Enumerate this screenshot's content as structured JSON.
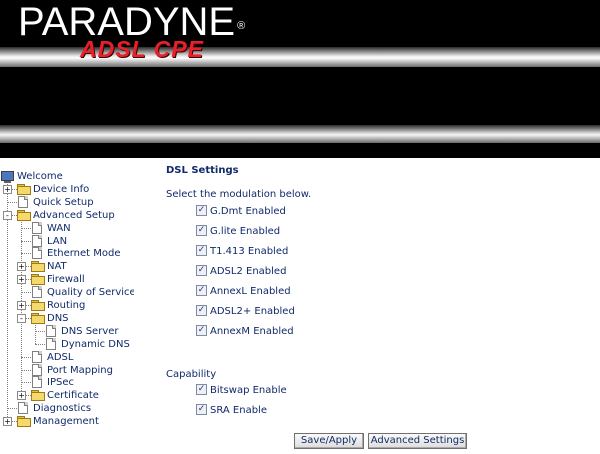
{
  "header": {
    "brand": "PARADYNE",
    "registered": "®",
    "subbrand": "ADSL CPE"
  },
  "tree": [
    {
      "label": "Welcome",
      "type": "root",
      "level": 0
    },
    {
      "label": "Device Info",
      "type": "folder",
      "level": 1,
      "expander": "+"
    },
    {
      "label": "Quick Setup",
      "type": "page",
      "level": 1
    },
    {
      "label": "Advanced Setup",
      "type": "folder-open",
      "level": 1,
      "expander": "-"
    },
    {
      "label": "WAN",
      "type": "page",
      "level": 2
    },
    {
      "label": "LAN",
      "type": "page",
      "level": 2
    },
    {
      "label": "Ethernet Mode",
      "type": "page",
      "level": 2
    },
    {
      "label": "NAT",
      "type": "folder",
      "level": 2,
      "expander": "+"
    },
    {
      "label": "Firewall",
      "type": "folder",
      "level": 2,
      "expander": "+"
    },
    {
      "label": "Quality of Service",
      "type": "page",
      "level": 2
    },
    {
      "label": "Routing",
      "type": "folder",
      "level": 2,
      "expander": "+"
    },
    {
      "label": "DNS",
      "type": "folder-open",
      "level": 2,
      "expander": "-"
    },
    {
      "label": "DNS Server",
      "type": "page",
      "level": 3
    },
    {
      "label": "Dynamic DNS",
      "type": "page",
      "level": 3
    },
    {
      "label": "ADSL",
      "type": "page",
      "level": 2
    },
    {
      "label": "Port Mapping",
      "type": "page",
      "level": 2
    },
    {
      "label": "IPSec",
      "type": "page",
      "level": 2
    },
    {
      "label": "Certificate",
      "type": "folder",
      "level": 2,
      "expander": "+"
    },
    {
      "label": "Diagnostics",
      "type": "page",
      "level": 1
    },
    {
      "label": "Management",
      "type": "folder",
      "level": 1,
      "expander": "+"
    }
  ],
  "main": {
    "title": "DSL Settings",
    "instruction": "Select the modulation below.",
    "modulations": [
      {
        "label": "G.Dmt Enabled",
        "checked": true
      },
      {
        "label": "G.lite Enabled",
        "checked": true
      },
      {
        "label": "T1.413 Enabled",
        "checked": true
      },
      {
        "label": "ADSL2 Enabled",
        "checked": true
      },
      {
        "label": "AnnexL Enabled",
        "checked": true
      },
      {
        "label": "ADSL2+ Enabled",
        "checked": true
      },
      {
        "label": "AnnexM Enabled",
        "checked": true
      }
    ],
    "capability_label": "Capability",
    "capabilities": [
      {
        "label": "Bitswap Enable",
        "checked": true
      },
      {
        "label": "SRA Enable",
        "checked": true
      }
    ],
    "buttons": {
      "save": "Save/Apply",
      "advanced": "Advanced Settings"
    }
  },
  "colors": {
    "text": "#102a6a",
    "header_bg": "#000000",
    "brand_red": "#e8202a"
  }
}
